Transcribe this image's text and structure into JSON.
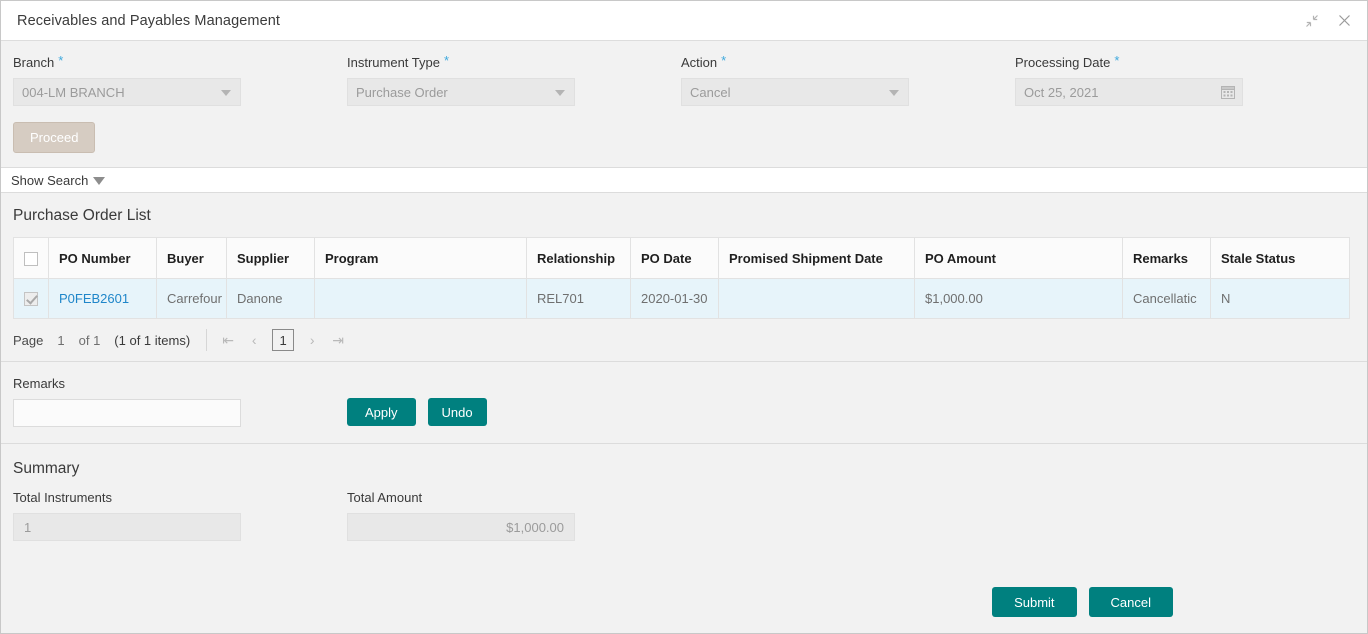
{
  "window": {
    "title": "Receivables and Payables Management",
    "minimize_icon": "collapse-arrows-icon",
    "close_icon": "close-icon"
  },
  "form": {
    "fields": [
      {
        "label": "Branch",
        "required": "*",
        "value": "004-LM BRANCH",
        "type": "select"
      },
      {
        "label": "Instrument Type",
        "required": "*",
        "value": "Purchase Order",
        "type": "select"
      },
      {
        "label": "Action",
        "required": "*",
        "value": "Cancel",
        "type": "select"
      },
      {
        "label": "Processing Date",
        "required": "*",
        "value": "Oct 25, 2021",
        "type": "date"
      }
    ],
    "proceed_label": "Proceed"
  },
  "show_search": {
    "label": "Show Search",
    "caret_icon": "caret-down-icon"
  },
  "list": {
    "title": "Purchase Order List",
    "columns": [
      "PO Number",
      "Buyer",
      "Supplier",
      "Program",
      "Relationship",
      "PO Date",
      "Promised Shipment Date",
      "PO Amount",
      "Remarks",
      "Stale Status"
    ],
    "rows": [
      {
        "selected": true,
        "po_number": "P0FEB2601",
        "buyer": "Carrefour",
        "supplier": "Danone",
        "program": "",
        "relationship": "REL701",
        "po_date": "2020-01-30",
        "promised_shipment_date": "",
        "po_amount": "$1,000.00",
        "remarks": "Cancellatic",
        "stale_status": "N"
      }
    ]
  },
  "pagination": {
    "page_label": "Page",
    "page_number": "1",
    "of_label": "of 1",
    "items_label": "(1 of 1 items)",
    "first_icon": "first-page-icon",
    "prev_icon": "prev-page-icon",
    "current_page": "1",
    "next_icon": "next-page-icon",
    "last_icon": "last-page-icon"
  },
  "remarks": {
    "label": "Remarks",
    "value": "",
    "placeholder": "",
    "apply_label": "Apply",
    "undo_label": "Undo"
  },
  "summary": {
    "title": "Summary",
    "total_instruments_label": "Total Instruments",
    "total_instruments_value": "1",
    "total_amount_label": "Total Amount",
    "total_amount_value": "$1,000.00"
  },
  "footer": {
    "submit_label": "Submit",
    "cancel_label": "Cancel"
  },
  "colors": {
    "accent_teal": "#00807f",
    "link_blue": "#1f86c9",
    "required_star": "#3fa9dd",
    "row_selected": "#e7f4fa",
    "proceed_disabled": "#d6ccc2"
  }
}
